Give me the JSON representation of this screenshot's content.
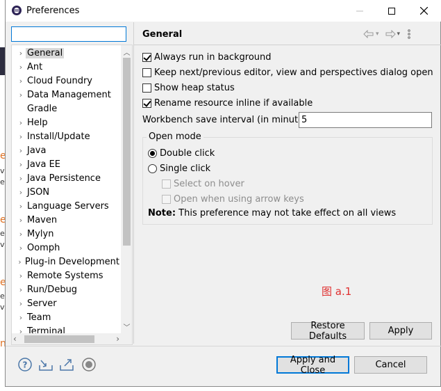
{
  "window": {
    "title": "Preferences",
    "minimize_icon": "minimize-icon",
    "maximize_icon": "maximize-icon",
    "close_icon": "close-icon"
  },
  "filter": {
    "value": "",
    "placeholder": ""
  },
  "tree": {
    "items": [
      {
        "label": "General",
        "expandable": true,
        "selected": true
      },
      {
        "label": "Ant",
        "expandable": true
      },
      {
        "label": "Cloud Foundry",
        "expandable": true
      },
      {
        "label": "Data Management",
        "expandable": true
      },
      {
        "label": "Gradle",
        "expandable": false
      },
      {
        "label": "Help",
        "expandable": true
      },
      {
        "label": "Install/Update",
        "expandable": true
      },
      {
        "label": "Java",
        "expandable": true
      },
      {
        "label": "Java EE",
        "expandable": true
      },
      {
        "label": "Java Persistence",
        "expandable": true
      },
      {
        "label": "JSON",
        "expandable": true
      },
      {
        "label": "Language Servers",
        "expandable": true
      },
      {
        "label": "Maven",
        "expandable": true
      },
      {
        "label": "Mylyn",
        "expandable": true
      },
      {
        "label": "Oomph",
        "expandable": true
      },
      {
        "label": "Plug-in Development",
        "expandable": true
      },
      {
        "label": "Remote Systems",
        "expandable": true
      },
      {
        "label": "Run/Debug",
        "expandable": true
      },
      {
        "label": "Server",
        "expandable": true
      },
      {
        "label": "Team",
        "expandable": true
      },
      {
        "label": "Terminal",
        "expandable": true
      }
    ]
  },
  "page": {
    "title": "General",
    "options": {
      "always_run_background": {
        "label": "Always run in background",
        "checked": true
      },
      "keep_next_prev": {
        "label": "Keep next/previous editor, view and perspectives dialog open",
        "checked": false
      },
      "show_heap": {
        "label": "Show heap status",
        "checked": false
      },
      "rename_inline": {
        "label": "Rename resource inline if available",
        "checked": true
      }
    },
    "save_interval": {
      "label": "Workbench save interval (in minutes):",
      "value": "5"
    },
    "open_mode": {
      "title": "Open mode",
      "double_click": "Double click",
      "single_click": "Single click",
      "select_on_hover": "Select on hover",
      "open_arrow_keys": "Open when using arrow keys",
      "selected": "double_click"
    },
    "note": {
      "bold": "Note:",
      "text": " This preference may not take effect on all views"
    },
    "annotation": "图 a.1"
  },
  "buttons": {
    "restore_defaults": "Restore Defaults",
    "apply": "Apply",
    "apply_and_close": "Apply and Close",
    "cancel": "Cancel"
  },
  "background_fragments": [
    "e",
    "v",
    "ef",
    "e",
    "e",
    "v",
    "e",
    "e",
    "v",
    "n"
  ]
}
